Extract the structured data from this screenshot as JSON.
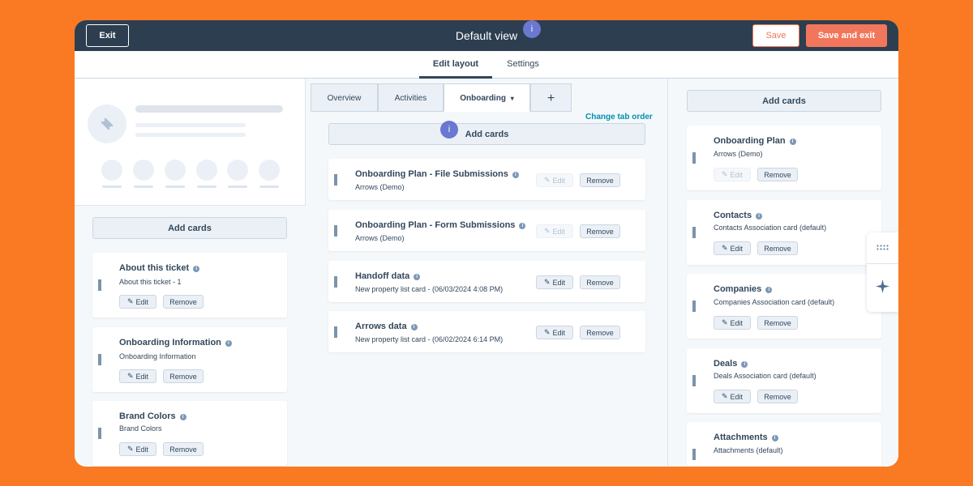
{
  "topbar": {
    "exit_label": "Exit",
    "title": "Default view",
    "info_glyph": "i",
    "save_label": "Save",
    "save_exit_label": "Save and exit"
  },
  "subtabs": [
    "Edit layout",
    "Settings"
  ],
  "left": {
    "add_cards_label": "Add cards",
    "cards": [
      {
        "title": "About this ticket",
        "subtitle": "About this ticket - 1",
        "edit": "Edit",
        "remove": "Remove"
      },
      {
        "title": "Onboarding Information",
        "subtitle": "Onboarding Information",
        "edit": "Edit",
        "remove": "Remove"
      },
      {
        "title": "Brand Colors",
        "subtitle": "Brand Colors",
        "edit": "Edit",
        "remove": "Remove"
      }
    ]
  },
  "middle": {
    "tabs": [
      "Overview",
      "Activities",
      "Onboarding",
      "+"
    ],
    "active_tab_caret": "▾",
    "change_tab_order_label": "Change tab order",
    "add_cards_label": "Add cards",
    "cards": [
      {
        "title": "Onboarding Plan - File Submissions",
        "subtitle": "Arrows (Demo)",
        "edit": "Edit",
        "remove": "Remove",
        "edit_disabled": true
      },
      {
        "title": "Onboarding Plan - Form Submissions",
        "subtitle": "Arrows (Demo)",
        "edit": "Edit",
        "remove": "Remove",
        "edit_disabled": true
      },
      {
        "title": "Handoff data",
        "subtitle": "New property list card - (06/03/2024 4:08 PM)",
        "edit": "Edit",
        "remove": "Remove",
        "edit_disabled": false
      },
      {
        "title": "Arrows data",
        "subtitle": "New property list card - (06/02/2024 6:14 PM)",
        "edit": "Edit",
        "remove": "Remove",
        "edit_disabled": false
      }
    ]
  },
  "right": {
    "add_cards_label": "Add cards",
    "cards": [
      {
        "title": "Onboarding Plan",
        "subtitle": "Arrows (Demo)",
        "edit": "Edit",
        "remove": "Remove",
        "edit_disabled": true
      },
      {
        "title": "Contacts",
        "subtitle": "Contacts Association card (default)",
        "edit": "Edit",
        "remove": "Remove",
        "edit_disabled": false
      },
      {
        "title": "Companies",
        "subtitle": "Companies Association card (default)",
        "edit": "Edit",
        "remove": "Remove",
        "edit_disabled": false
      },
      {
        "title": "Deals",
        "subtitle": "Deals Association card (default)",
        "edit": "Edit",
        "remove": "Remove",
        "edit_disabled": false
      },
      {
        "title": "Attachments",
        "subtitle": "Attachments (default)"
      }
    ]
  },
  "icons": {
    "info": "info-icon",
    "pencil": "pencil-icon",
    "drag": "drag-handle-icon",
    "grid": "grid-dots-icon",
    "sparkle": "sparkle-icon"
  },
  "colors": {
    "background": "#f97a22",
    "topbar": "#2d3e50",
    "accent": "#f2765b",
    "link": "#0091ae",
    "info_badge": "#6a78d1"
  }
}
